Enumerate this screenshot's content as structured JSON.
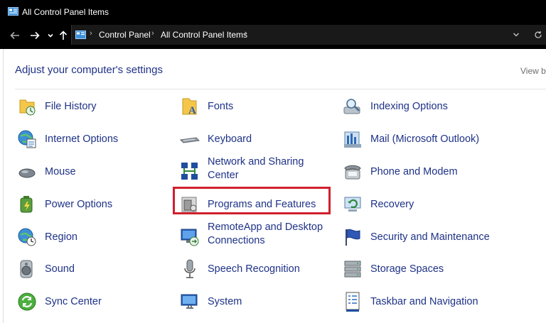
{
  "window": {
    "title": "All Control Panel Items"
  },
  "nav": {
    "back_icon": "back-arrow-icon",
    "forward_icon": "forward-arrow-icon",
    "recent_icon": "chevron-down-icon",
    "up_icon": "up-arrow-icon",
    "breadcrumbs": [
      "Control Panel",
      "All Control Panel Items"
    ],
    "dropdown_icon": "chevron-down-icon",
    "refresh_icon": "refresh-icon"
  },
  "content": {
    "heading": "Adjust your computer's settings",
    "view_by": "View by"
  },
  "items": [
    {
      "label": "File History",
      "icon": "file-history-icon"
    },
    {
      "label": "Fonts",
      "icon": "fonts-icon"
    },
    {
      "label": "Indexing Options",
      "icon": "indexing-options-icon"
    },
    {
      "label": "Internet Options",
      "icon": "internet-options-icon"
    },
    {
      "label": "Keyboard",
      "icon": "keyboard-icon"
    },
    {
      "label": "Mail (Microsoft Outlook)",
      "icon": "mail-icon"
    },
    {
      "label": "Mouse",
      "icon": "mouse-icon"
    },
    {
      "label": "Network and Sharing Center",
      "label_line1": "Network and Sharing",
      "label_line2": "Center",
      "icon": "network-icon"
    },
    {
      "label": "Phone and Modem",
      "icon": "phone-icon"
    },
    {
      "label": "Power Options",
      "icon": "power-options-icon"
    },
    {
      "label": "Programs and Features",
      "icon": "programs-features-icon",
      "highlighted": true
    },
    {
      "label": "Recovery",
      "icon": "recovery-icon"
    },
    {
      "label": "Region",
      "icon": "region-icon"
    },
    {
      "label": "RemoteApp and Desktop Connections",
      "label_line1": "RemoteApp and Desktop",
      "label_line2": "Connections",
      "icon": "remoteapp-icon"
    },
    {
      "label": "Security and Maintenance",
      "icon": "security-flag-icon"
    },
    {
      "label": "Sound",
      "icon": "speaker-icon"
    },
    {
      "label": "Speech Recognition",
      "icon": "microphone-icon"
    },
    {
      "label": "Storage Spaces",
      "icon": "storage-spaces-icon"
    },
    {
      "label": "Sync Center",
      "icon": "sync-center-icon"
    },
    {
      "label": "System",
      "icon": "system-monitor-icon"
    },
    {
      "label": "Taskbar and Navigation",
      "icon": "taskbar-icon"
    }
  ],
  "colors": {
    "link": "#1e3287",
    "highlight_border": "#d0202d",
    "titlebar": "#000000"
  }
}
